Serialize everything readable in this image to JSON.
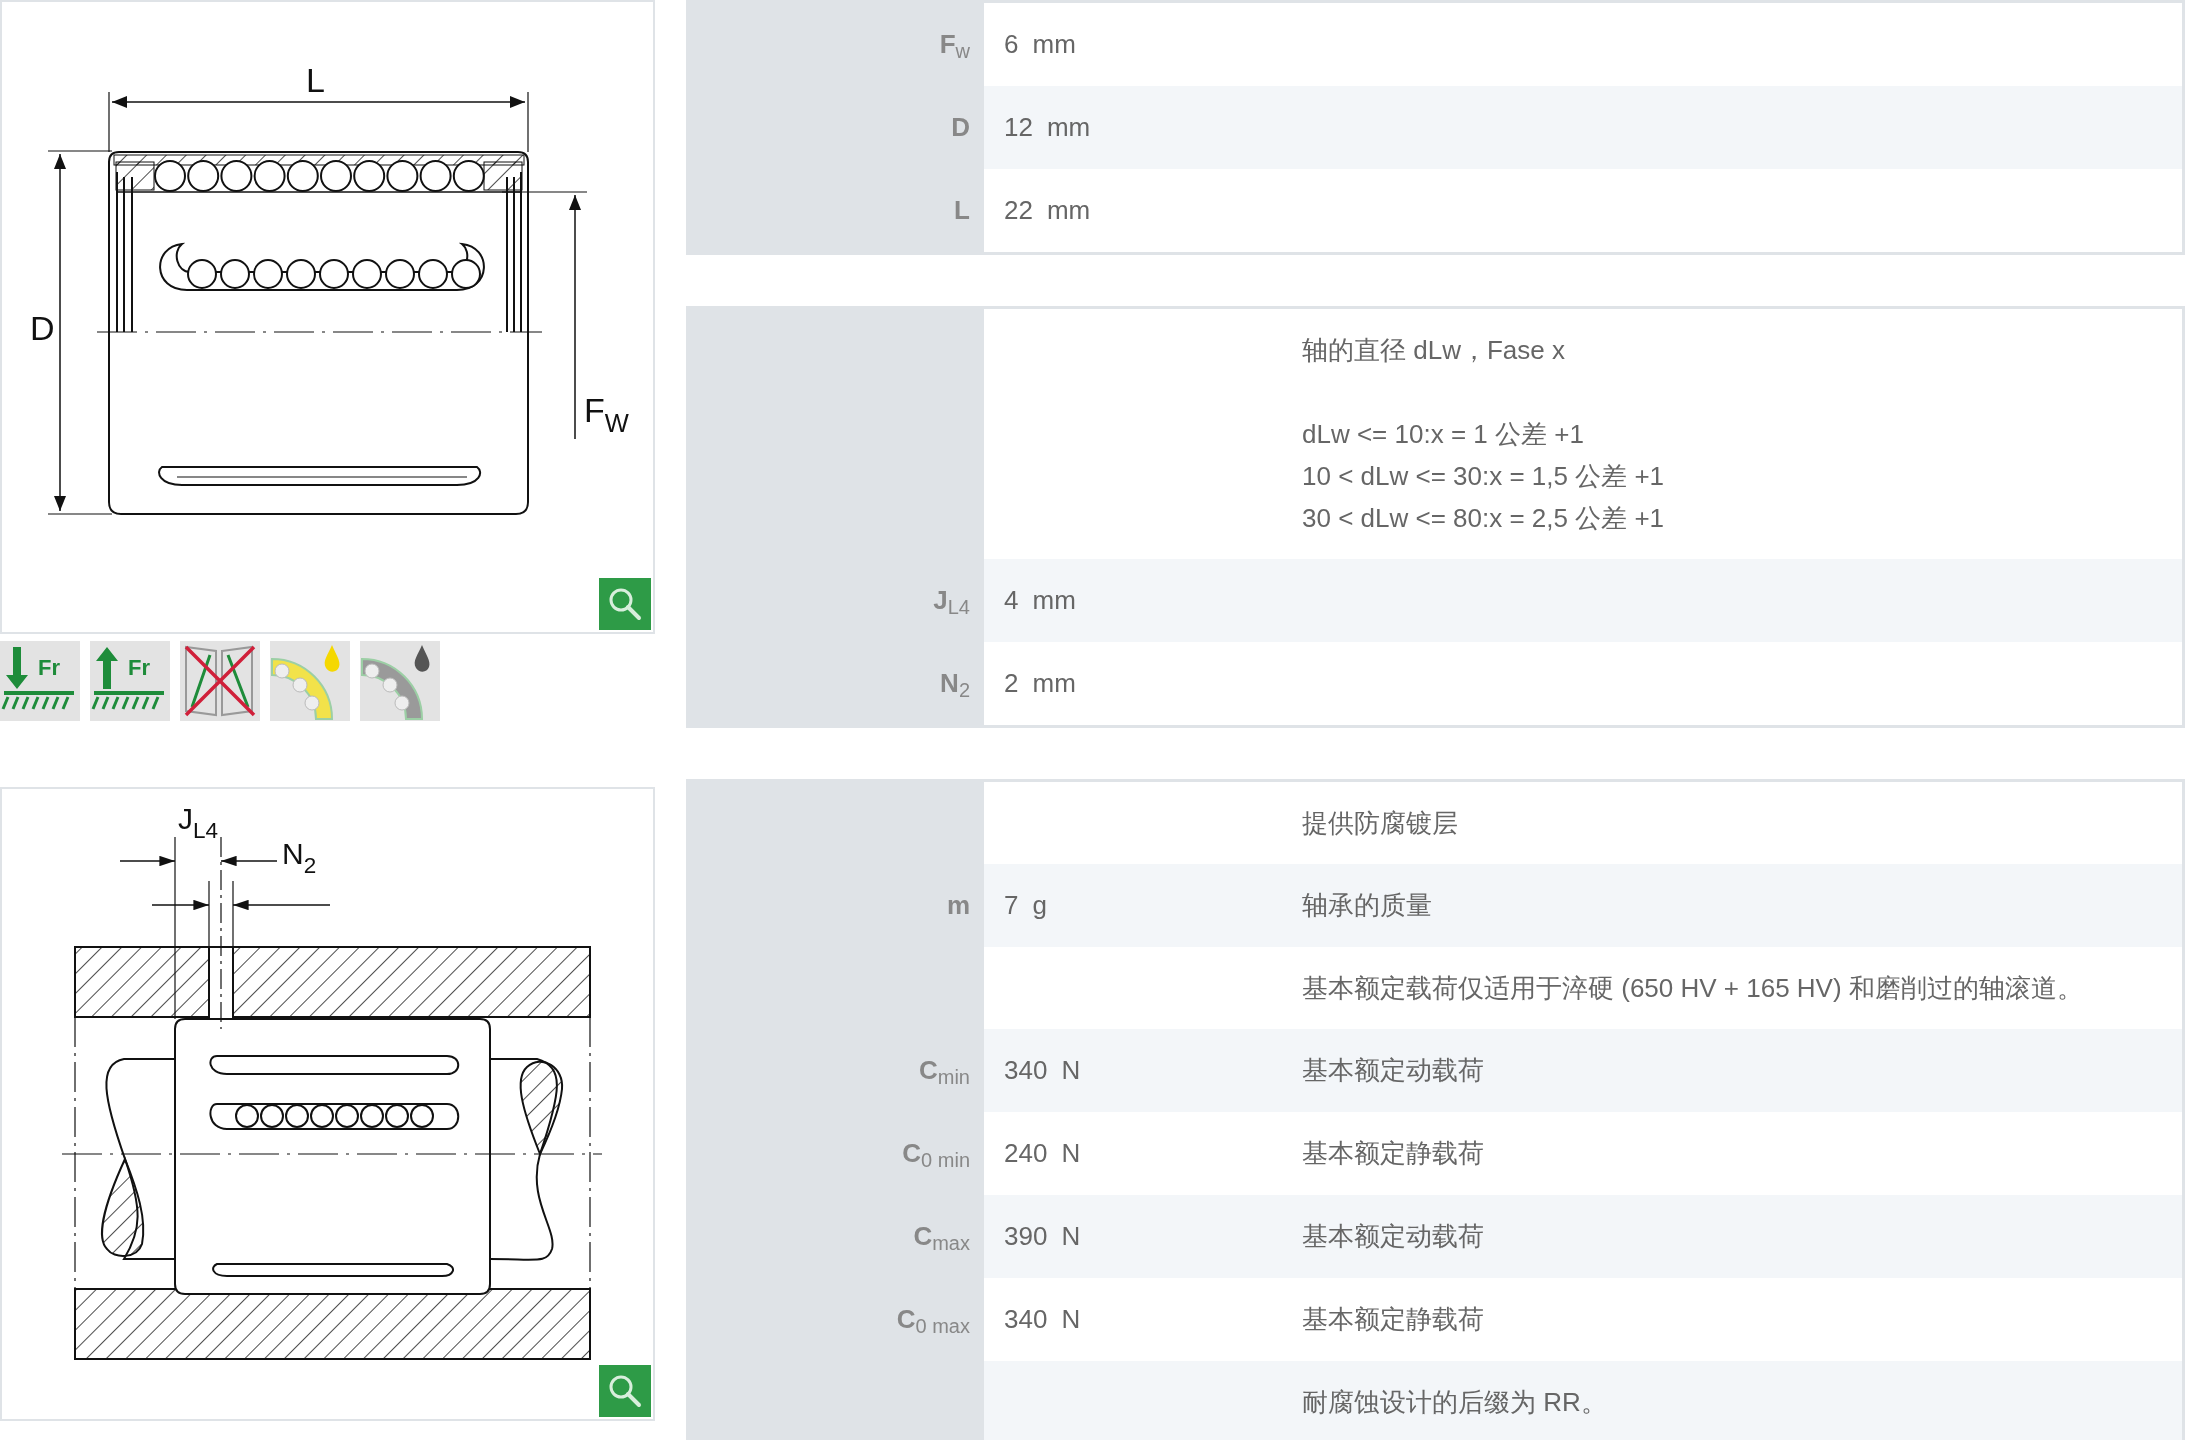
{
  "drawings": [
    {
      "kind": "bearing",
      "labels": [
        {
          "main": "L"
        },
        {
          "main": "D"
        },
        {
          "main": "F",
          "sub": "W"
        }
      ]
    },
    {
      "kind": "mounting",
      "labels": [
        {
          "main": "J",
          "sub": "L4"
        },
        {
          "main": "N",
          "sub": "2"
        }
      ]
    }
  ],
  "feature_icons": [
    {
      "kind": "load-down",
      "label": "Fr"
    },
    {
      "kind": "load-up",
      "label": "Fr"
    },
    {
      "kind": "no-tilt"
    },
    {
      "kind": "oil"
    },
    {
      "kind": "grease"
    }
  ],
  "tables": [
    {
      "rows": [
        {
          "symbol": "F$_{w}$",
          "value": "6",
          "unit": "mm"
        },
        {
          "symbol": "D",
          "value": "12",
          "unit": "mm"
        },
        {
          "symbol": "L",
          "value": "22",
          "unit": "mm"
        }
      ]
    },
    {
      "rows": [
        {
          "notes": [
            "轴的直径 dLw，Fase x",
            "dLw <= 10:x = 1 公差 +1",
            "10 < dLw <= 30:x = 1,5 公差 +1",
            "30 < dLw <= 80:x = 2,5 公差 +1"
          ]
        },
        {
          "symbol": "J$_{L4}$",
          "value": "4",
          "unit": "mm"
        },
        {
          "symbol": "N$_{2}$",
          "value": "2",
          "unit": "mm"
        }
      ]
    },
    {
      "rows": [
        {
          "notes": [
            "提供防腐镀层"
          ]
        },
        {
          "symbol": "m",
          "value": "7",
          "unit": "g",
          "notes": [
            "轴承的质量"
          ]
        },
        {
          "notes": [
            "基本额定载荷仅适用于淬硬 (650 HV + 165 HV) 和磨削过的轴滚道。"
          ]
        },
        {
          "symbol": "C$_{min}$",
          "value": "340",
          "unit": "N",
          "notes": [
            "基本额定动载荷"
          ]
        },
        {
          "symbol": "C$_{0 min}$",
          "value": "240",
          "unit": "N",
          "notes": [
            "基本额定静载荷"
          ]
        },
        {
          "symbol": "C$_{max}$",
          "value": "390",
          "unit": "N",
          "notes": [
            "基本额定动载荷"
          ]
        },
        {
          "symbol": "C$_{0 max}$",
          "value": "340",
          "unit": "N",
          "notes": [
            "基本额定静载荷"
          ]
        },
        {
          "notes": [
            "耐腐蚀设计的后缀为 RR。"
          ]
        }
      ]
    }
  ]
}
